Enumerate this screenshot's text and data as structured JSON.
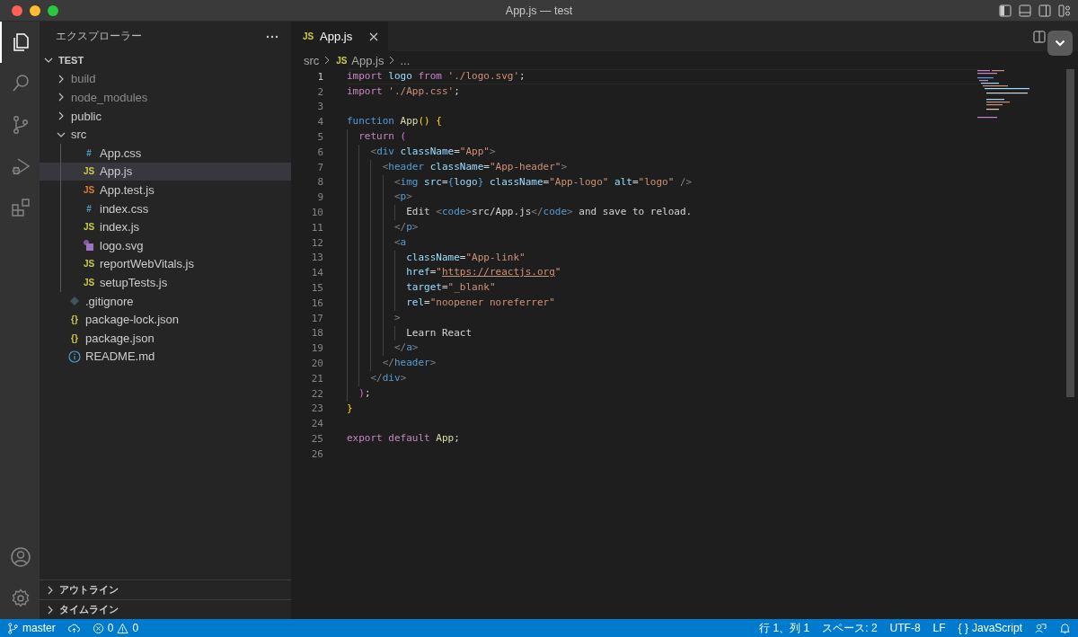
{
  "window": {
    "title": "App.js — test"
  },
  "activity_bar": [
    {
      "kind": "explorer",
      "selected": true
    },
    {
      "kind": "search",
      "selected": false
    },
    {
      "kind": "source-control",
      "selected": false
    },
    {
      "kind": "run",
      "selected": false
    },
    {
      "kind": "extensions",
      "selected": false
    }
  ],
  "sidebar": {
    "title": "エクスプローラー",
    "root": {
      "label": "TEST",
      "expanded": true
    },
    "items": [
      {
        "kind": "folder",
        "label": "build",
        "expanded": false,
        "selected": false
      },
      {
        "kind": "folder",
        "label": "node_modules",
        "expanded": false,
        "selected": false
      },
      {
        "kind": "folder",
        "label": "public",
        "expanded": false,
        "selected": false
      },
      {
        "kind": "folder",
        "label": "src",
        "expanded": true,
        "selected": false,
        "children": [
          {
            "kind": "css",
            "badge": "#",
            "label": "App.css",
            "selected": false
          },
          {
            "kind": "js",
            "badge": "JS",
            "label": "App.js",
            "selected": true
          },
          {
            "kind": "test",
            "badge": "JS",
            "label": "App.test.js",
            "selected": false
          },
          {
            "kind": "css",
            "badge": "#",
            "label": "index.css",
            "selected": false
          },
          {
            "kind": "js",
            "badge": "JS",
            "label": "index.js",
            "selected": false
          },
          {
            "kind": "svg",
            "label": "logo.svg",
            "selected": false
          },
          {
            "kind": "js",
            "badge": "JS",
            "label": "reportWebVitals.js",
            "selected": false
          },
          {
            "kind": "js",
            "badge": "JS",
            "label": "setupTests.js",
            "selected": false
          }
        ]
      },
      {
        "kind": "git",
        "label": ".gitignore",
        "selected": false
      },
      {
        "kind": "json",
        "badge": "{}",
        "label": "package-lock.json",
        "selected": false
      },
      {
        "kind": "json",
        "badge": "{}",
        "label": "package.json",
        "selected": false
      },
      {
        "kind": "info",
        "label": "README.md",
        "selected": false
      }
    ],
    "panels": [
      {
        "label": "アウトライン",
        "expanded": false
      },
      {
        "label": "タイムライン",
        "expanded": false
      }
    ]
  },
  "tabs": [
    {
      "badge": "JS",
      "label": "App.js",
      "selected": true
    }
  ],
  "breadcrumb": [
    {
      "label": "src"
    },
    {
      "badge": "JS",
      "label": "App.js"
    },
    {
      "label": "..."
    }
  ],
  "code": [
    {
      "number": "1",
      "current": true,
      "tokens": [
        {
          "kind": "kw",
          "text": "import "
        },
        {
          "kind": "var",
          "text": "logo "
        },
        {
          "kind": "kw",
          "text": "from "
        },
        {
          "kind": "str",
          "text": "'./logo.svg'"
        },
        {
          "kind": "text",
          "text": ";"
        }
      ]
    },
    {
      "number": "2",
      "current": false,
      "tokens": [
        {
          "kind": "kw",
          "text": "import "
        },
        {
          "kind": "str",
          "text": "'./App.css'"
        },
        {
          "kind": "text",
          "text": ";"
        }
      ]
    },
    {
      "number": "3",
      "current": false
    },
    {
      "number": "4",
      "current": false,
      "tokens": [
        {
          "kind": "tag",
          "text": "function "
        },
        {
          "kind": "fn",
          "text": "App"
        },
        {
          "kind": "brace",
          "text": "() {"
        }
      ]
    },
    {
      "number": "5",
      "current": false,
      "tokens": [
        {
          "kind": "kw",
          "text": "  return "
        },
        {
          "kind": "paren",
          "text": "("
        }
      ]
    },
    {
      "number": "6",
      "current": false,
      "tokens": [
        {
          "kind": "punct",
          "text": "    <"
        },
        {
          "kind": "tag",
          "text": "div"
        },
        {
          "kind": "var",
          "text": " className"
        },
        {
          "kind": "text",
          "text": "="
        },
        {
          "kind": "str",
          "text": "\"App\""
        },
        {
          "kind": "punct",
          "text": ">"
        }
      ]
    },
    {
      "number": "7",
      "current": false,
      "tokens": [
        {
          "kind": "punct",
          "text": "      <"
        },
        {
          "kind": "tag",
          "text": "header"
        },
        {
          "kind": "var",
          "text": " className"
        },
        {
          "kind": "text",
          "text": "="
        },
        {
          "kind": "str",
          "text": "\"App-header\""
        },
        {
          "kind": "punct",
          "text": ">"
        }
      ]
    },
    {
      "number": "8",
      "current": false,
      "tokens": [
        {
          "kind": "punct",
          "text": "        <"
        },
        {
          "kind": "tag",
          "text": "img"
        },
        {
          "kind": "var",
          "text": " src"
        },
        {
          "kind": "text",
          "text": "="
        },
        {
          "kind": "tag",
          "text": "{"
        },
        {
          "kind": "var",
          "text": "logo"
        },
        {
          "kind": "tag",
          "text": "}"
        },
        {
          "kind": "var",
          "text": " className"
        },
        {
          "kind": "text",
          "text": "="
        },
        {
          "kind": "str",
          "text": "\"App-logo\""
        },
        {
          "kind": "var",
          "text": " alt"
        },
        {
          "kind": "text",
          "text": "="
        },
        {
          "kind": "str",
          "text": "\"logo\""
        },
        {
          "kind": "punct",
          "text": " />"
        }
      ]
    },
    {
      "number": "9",
      "current": false,
      "tokens": [
        {
          "kind": "punct",
          "text": "        <"
        },
        {
          "kind": "tag",
          "text": "p"
        },
        {
          "kind": "punct",
          "text": ">"
        }
      ]
    },
    {
      "number": "10",
      "current": false,
      "tokens": [
        {
          "kind": "text",
          "text": "          Edit "
        },
        {
          "kind": "punct",
          "text": "<"
        },
        {
          "kind": "tag",
          "text": "code"
        },
        {
          "kind": "punct",
          "text": ">"
        },
        {
          "kind": "text",
          "text": "src/App.js"
        },
        {
          "kind": "punct",
          "text": "</"
        },
        {
          "kind": "tag",
          "text": "code"
        },
        {
          "kind": "punct",
          "text": ">"
        },
        {
          "kind": "text",
          "text": " and save to reload."
        }
      ]
    },
    {
      "number": "11",
      "current": false,
      "tokens": [
        {
          "kind": "punct",
          "text": "        </"
        },
        {
          "kind": "tag",
          "text": "p"
        },
        {
          "kind": "punct",
          "text": ">"
        }
      ]
    },
    {
      "number": "12",
      "current": false,
      "tokens": [
        {
          "kind": "punct",
          "text": "        <"
        },
        {
          "kind": "tag",
          "text": "a"
        }
      ]
    },
    {
      "number": "13",
      "current": false,
      "tokens": [
        {
          "kind": "var",
          "text": "          className"
        },
        {
          "kind": "text",
          "text": "="
        },
        {
          "kind": "str",
          "text": "\"App-link\""
        }
      ]
    },
    {
      "number": "14",
      "current": false,
      "tokens": [
        {
          "kind": "var",
          "text": "          href"
        },
        {
          "kind": "text",
          "text": "="
        },
        {
          "kind": "str",
          "text": "\""
        },
        {
          "kind": "url",
          "text": "https://reactjs.org"
        },
        {
          "kind": "str",
          "text": "\""
        }
      ]
    },
    {
      "number": "15",
      "current": false,
      "tokens": [
        {
          "kind": "var",
          "text": "          target"
        },
        {
          "kind": "text",
          "text": "="
        },
        {
          "kind": "str",
          "text": "\"_blank\""
        }
      ]
    },
    {
      "number": "16",
      "current": false,
      "tokens": [
        {
          "kind": "var",
          "text": "          rel"
        },
        {
          "kind": "text",
          "text": "="
        },
        {
          "kind": "str",
          "text": "\"noopener noreferrer\""
        }
      ]
    },
    {
      "number": "17",
      "current": false,
      "tokens": [
        {
          "kind": "punct",
          "text": "        >"
        }
      ]
    },
    {
      "number": "18",
      "current": false,
      "tokens": [
        {
          "kind": "text",
          "text": "          Learn React"
        }
      ]
    },
    {
      "number": "19",
      "current": false,
      "tokens": [
        {
          "kind": "punct",
          "text": "        </"
        },
        {
          "kind": "tag",
          "text": "a"
        },
        {
          "kind": "punct",
          "text": ">"
        }
      ]
    },
    {
      "number": "20",
      "current": false,
      "tokens": [
        {
          "kind": "punct",
          "text": "      </"
        },
        {
          "kind": "tag",
          "text": "header"
        },
        {
          "kind": "punct",
          "text": ">"
        }
      ]
    },
    {
      "number": "21",
      "current": false,
      "tokens": [
        {
          "kind": "punct",
          "text": "    </"
        },
        {
          "kind": "tag",
          "text": "div"
        },
        {
          "kind": "punct",
          "text": ">"
        }
      ]
    },
    {
      "number": "22",
      "current": false,
      "tokens": [
        {
          "kind": "paren",
          "text": "  )"
        },
        {
          "kind": "text",
          "text": ";"
        }
      ]
    },
    {
      "number": "23",
      "current": false,
      "tokens": [
        {
          "kind": "brace",
          "text": "}"
        }
      ]
    },
    {
      "number": "24",
      "current": false
    },
    {
      "number": "25",
      "current": false,
      "tokens": [
        {
          "kind": "kw",
          "text": "export default "
        },
        {
          "kind": "fn",
          "text": "App"
        },
        {
          "kind": "text",
          "text": ";"
        }
      ]
    },
    {
      "number": "26",
      "current": false
    }
  ],
  "status_bar": {
    "branch": "master",
    "errors": "0",
    "warnings": "0",
    "position": "行 1、列 1",
    "indent": "スペース: 2",
    "encoding": "UTF-8",
    "eol": "LF",
    "language_icon": "{ }",
    "language": "JavaScript"
  }
}
